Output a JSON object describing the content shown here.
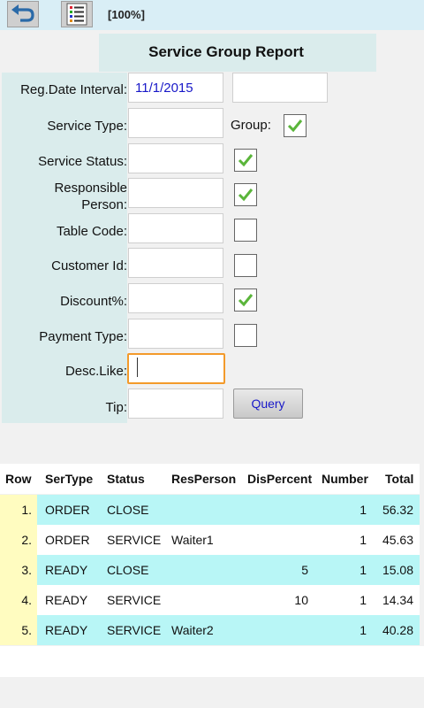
{
  "toolbar": {
    "zoom": "[100%]",
    "back_icon": "undo-arrow-icon",
    "report_icon": "report-list-icon"
  },
  "form": {
    "title": "Service Group Report",
    "fields": {
      "reg_date": {
        "label": "Reg.Date Interval:",
        "value": "11/1/2015",
        "value2": ""
      },
      "service_type": {
        "label": "Service Type:",
        "value": ""
      },
      "service_status": {
        "label": "Service Status:",
        "value": "",
        "checked": true
      },
      "responsible_person": {
        "label_line1": "Responsible",
        "label_line2": "Person:",
        "value": "",
        "checked": true
      },
      "table_code": {
        "label": "Table Code:",
        "value": "",
        "checked": false
      },
      "customer_id": {
        "label": "Customer Id:",
        "value": "",
        "checked": false
      },
      "discount": {
        "label": "Discount%:",
        "value": "",
        "checked": true
      },
      "payment_type": {
        "label": "Payment Type:",
        "value": "",
        "checked": false
      },
      "desc_like": {
        "label": "Desc.Like:",
        "value": ""
      },
      "tip": {
        "label": "Tip:",
        "value": ""
      }
    },
    "group": {
      "label": "Group:",
      "checked": true
    },
    "query_label": "Query"
  },
  "table": {
    "headers": [
      "Row",
      "SerType",
      "Status",
      "ResPerson",
      "DisPercent",
      "Number",
      "Total"
    ],
    "rows": [
      {
        "row": "1.",
        "sertype": "ORDER",
        "status": "CLOSE",
        "resperson": "",
        "dispercent": "",
        "number": "1",
        "total": "56.32"
      },
      {
        "row": "2.",
        "sertype": "ORDER",
        "status": "SERVICE",
        "resperson": "Waiter1",
        "dispercent": "",
        "number": "1",
        "total": "45.63"
      },
      {
        "row": "3.",
        "sertype": "READY",
        "status": "CLOSE",
        "resperson": "",
        "dispercent": "5",
        "number": "1",
        "total": "15.08"
      },
      {
        "row": "4.",
        "sertype": "READY",
        "status": "SERVICE",
        "resperson": "",
        "dispercent": "10",
        "number": "1",
        "total": "14.34"
      },
      {
        "row": "5.",
        "sertype": "READY",
        "status": "SERVICE",
        "resperson": "Waiter2",
        "dispercent": "",
        "number": "1",
        "total": "40.28"
      }
    ]
  },
  "colors": {
    "toolbar_bg": "#d9eef6",
    "panel_bg": "#daecec",
    "row_cyan": "#b8f6f6",
    "row_yellow": "#fffcc0",
    "link_blue": "#1818c8",
    "focus_orange": "#f39a2b",
    "check_green": "#5ab53a"
  }
}
